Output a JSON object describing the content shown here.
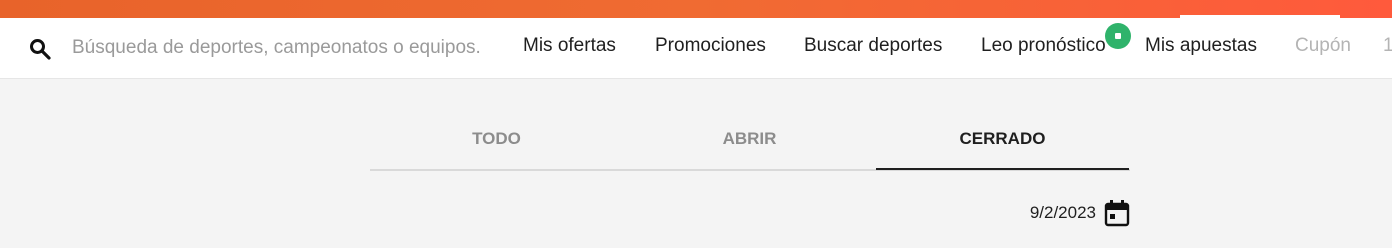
{
  "search": {
    "placeholder": "Búsqueda de deportes, campeonatos o equipos.",
    "icon": "search-icon"
  },
  "nav": {
    "items": [
      {
        "label": "Mis ofertas"
      },
      {
        "label": "Promociones"
      },
      {
        "label": "Buscar deportes"
      },
      {
        "label": "Leo pronóstico"
      },
      {
        "label": "Mis apuestas"
      },
      {
        "label": "Cupón"
      },
      {
        "label": "1"
      }
    ]
  },
  "tabs": [
    {
      "label": "TODO"
    },
    {
      "label": "ABRIR"
    },
    {
      "label": "CERRADO",
      "active": true
    }
  ],
  "date_filter": {
    "value": "9/2/2023",
    "icon": "calendar-icon"
  },
  "colors": {
    "brand_orange": "#f06b32",
    "badge_green": "#2fb36b",
    "page_bg": "#f4f4f4"
  }
}
